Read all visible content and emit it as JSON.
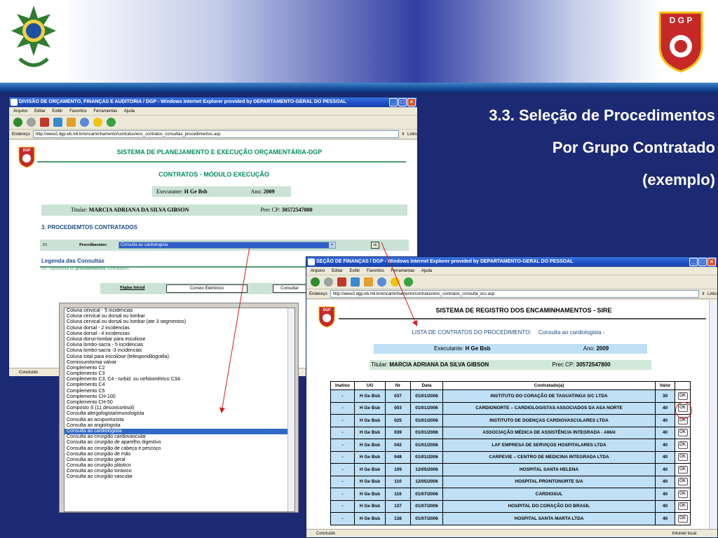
{
  "slide": {
    "title_lines": [
      "3.3. Seleção de Procedimentos",
      "Por Grupo Contratado",
      "(exemplo)"
    ],
    "dgp_logo_text": "D G P"
  },
  "colors": {
    "slide_bg": "#1c2a73",
    "table_row": "#bfe0f5",
    "green_text": "#008b63"
  },
  "window1": {
    "title": "DIVISÃO DE ORÇAMENTO, FINANÇAS E AUDITORIA / DGP - Windows Internet Explorer provided by DEPARTAMENTO-GERAL DO PESSOAL",
    "menu": [
      "Arquivo",
      "Editar",
      "Exibir",
      "Favoritos",
      "Ferramentas",
      "Ajuda"
    ],
    "address_label": "Endereço",
    "address": "http://www2.dgp.eb.mil.br/encaminhamento/contratos/enc_contratos_consultas_procedimentos.asp",
    "go_label": "Ir",
    "links_label": "Links",
    "shield_text": "DGP",
    "system_title": "SISTEMA DE PLANEJAMENTO E EXECUÇÃO ORÇAMENTÁRIA-DGP",
    "module_title": "CONTRATOS - MÓDULO EXECUÇÃO",
    "executante_label": "Executante:",
    "executante": "H Ge Bsb",
    "ano_label": "Ano:",
    "ano": "2009",
    "titular_label": "Titular:",
    "titular": "MARCIA ADRIANA DA SILVA GIBSON",
    "prec_label": "Prec CP:",
    "prec": "30572547800",
    "section": "3. PROCEDIEMTOS CONTRATADOS",
    "row_code": "03",
    "row_label": "Procedimentos:",
    "selected_proc": "Consulta ao cardiologista",
    "ok_label": "ok",
    "legend_title": "Legenda das Consultas",
    "legend_prefix": "03 - Apresenta os",
    "legend_bold": "procedimentos",
    "legend_suffix": "contratados.",
    "footer_link": "Página Inicial",
    "btn_email": "Correio Eletrônico",
    "btn_consult": "Consultar",
    "status": "Concluído"
  },
  "dropdown": {
    "items": [
      "Coluna cervical - 5 incidencias",
      "Coluna cervical ou dorsal ou lombar",
      "Coluna cervical ou dorsal ou lombar (ate 3 segmentos)",
      "Coluna dorsal - 2 incidencias",
      "Coluna dorsal - 4 incidencias",
      "Coluna dorso-lombar para escoliose",
      "Coluna lombo-sacra - 5 incidencias",
      "Coluna lombo-sacra -3 incidencias",
      "Coluna total para escoliose (telespondilografia)",
      "Comissurotomia valvar",
      "Complemento C2",
      "Complemento C3",
      "Complemento C3, C4 - turbid. ou nefolométrico C3A",
      "Complemento C4",
      "Complemento C5",
      "Complemento CH-100",
      "Complemento CH-50",
      "Composto S (11 desoxicortisol)",
      "Consulta alergologista/imunologista",
      "Consulta ao acupunturista",
      "Consulta ao angiologista",
      "Consulta ao cardiologista",
      "Consulta ao cirurgião cardiovascular",
      "Consulta ao cirurgião de aparelho digestivo",
      "Consulta ao cirurgião de cabeça e pescoço",
      "Consulta ao cirurgião de mão",
      "Consulta ao cirurgião geral",
      "Consulta ao cirurgião plástico",
      "Consulta ao cirurgião toráxico",
      "Consulta ao cirurgião vascular"
    ],
    "selected_index": 21
  },
  "window2": {
    "title": "SEÇÃO DE FINANÇAS / DGP - Windows Internet Explorer provided by DEPARTAMENTO-GERAL DO PESSOAL",
    "menu": [
      "Arquivo",
      "Editar",
      "Exibir",
      "Favoritos",
      "Ferramentas",
      "Ajuda"
    ],
    "address_label": "Endereço",
    "address": "http://www2.dgp.eb.mil.br/encaminhamento/contratos/enc_contratos_consulta_ocs.asp",
    "go_label": "Ir",
    "links_label": "Links",
    "shield_text": "DGP",
    "system_title": "SISTEMA DE REGISTRO DOS ENCAMINHAMENTOS - SIRE",
    "list_label": "LISTA DE CONTRATOS DO PROCEDIMENTO:",
    "list_proc": "Consulta ao cardiologista -",
    "executante_label": "Executante:",
    "executante": "H Ge Bsb",
    "ano_label": "Ano:",
    "ano": "2009",
    "titular_label": "Titular:",
    "titular": "MARCIA ADRIANA DA SILVA GIBSON",
    "prec_label": "Prec CP:",
    "prec": "30572547800",
    "table": {
      "headers": [
        "Inativo",
        "UG",
        "Nr",
        "Data",
        "Contratado(a)",
        "Valor",
        ""
      ],
      "rows": [
        [
          "-",
          "H Ge Bsb",
          "037",
          "01/01/2006",
          "INSTITUTO DO CORAÇÃO DE TAGUATINGA S/C LTDA",
          "30"
        ],
        [
          "-",
          "H Ge Bsb",
          "003",
          "01/01/2006",
          "CARDIONORTE – CARDIOLOGISTAS ASSOCIADOS DA ASA NORTE",
          "40"
        ],
        [
          "-",
          "H Ge Bsb",
          "025",
          "01/01/2006",
          "INSTITUTO DE DOENÇAS CARDIOVASCULARES LTDA",
          "40"
        ],
        [
          "-",
          "H Ge Bsb",
          "039",
          "01/01/2006",
          "ASSOCIAÇÃO MÉDICA DE ASSISTÊNCIA INTEGRADA - AMAI",
          "40"
        ],
        [
          "-",
          "H Ge Bsb",
          "042",
          "01/01/2006",
          "LAF EMPRESA DE SERVIÇOS HOSPITALARES LTDA",
          "40"
        ],
        [
          "-",
          "H Ge Bsb",
          "048",
          "01/01/2006",
          "CARPEVIE – CENTRO DE MEDICINA INTEGRADA LTDA",
          "40"
        ],
        [
          "-",
          "H Ge Bsb",
          "109",
          "12/05/2006",
          "HOSPITAL SANTA HELENA",
          "40"
        ],
        [
          "-",
          "H Ge Bsb",
          "110",
          "12/05/2006",
          "HOSPITAL PRONTONORTE S/A",
          "40"
        ],
        [
          "-",
          "H Ge Bsb",
          "116",
          "01/07/2006",
          "CARDIOSUL",
          "40"
        ],
        [
          "-",
          "H Ge Bsb",
          "137",
          "01/07/2006",
          "HOSPITAL DO CORAÇÃO DO BRASIL",
          "40"
        ],
        [
          "-",
          "H Ge Bsb",
          "138",
          "01/07/2006",
          "HOSPITAL SANTA MARTA LTDA",
          "40"
        ]
      ],
      "ok_label": "OK",
      "highlighted_row": 1
    },
    "status": "Concluído",
    "status_zone": "Intranet local"
  }
}
